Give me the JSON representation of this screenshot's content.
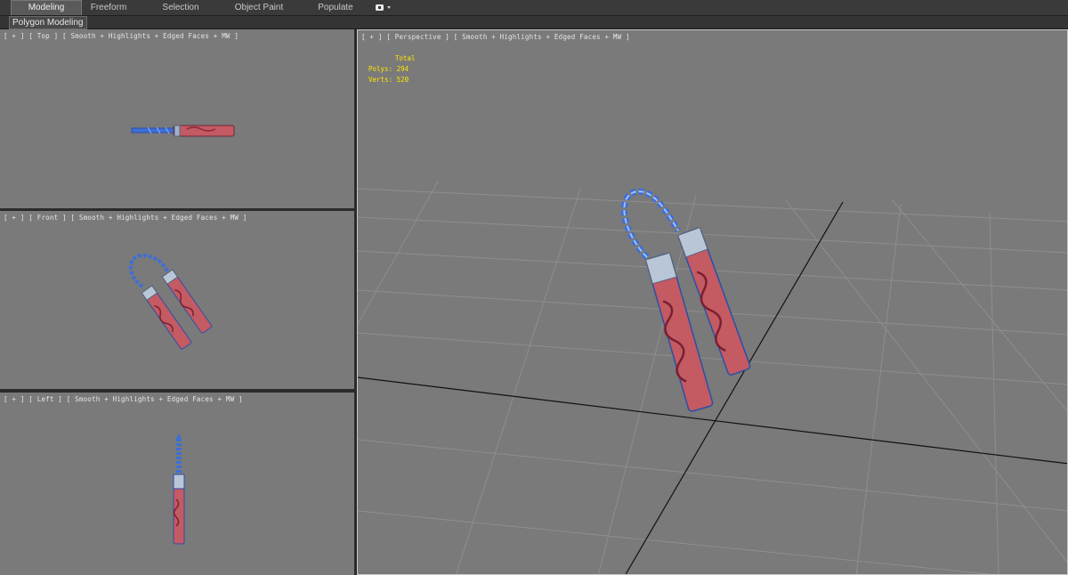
{
  "ribbon": {
    "tabs": [
      {
        "label": "Modeling",
        "active": true
      },
      {
        "label": "Freeform",
        "active": false
      },
      {
        "label": "Selection",
        "active": false
      },
      {
        "label": "Object Paint",
        "active": false
      },
      {
        "label": "Populate",
        "active": false
      }
    ],
    "dropdown_icon": "display-toggle-icon"
  },
  "subbar": {
    "panel_label": "Polygon Modeling"
  },
  "viewports": {
    "top": {
      "label": "[ + ] [ Top ] [ Smooth + Highlights + Edged Faces + MW ]"
    },
    "front": {
      "label": "[ + ] [ Front ] [ Smooth + Highlights + Edged Faces + MW ]"
    },
    "left": {
      "label": "[ + ] [ Left ] [ Smooth + Highlights + Edged Faces + MW ]"
    },
    "perspective": {
      "label": "[ + ] [ Perspective ] [ Smooth + Highlights + Edged Faces + MW ]",
      "stats": {
        "header": "Total",
        "polys": "Polys: 294",
        "verts": "Verts: 520"
      }
    }
  },
  "colors": {
    "viewport_bg": "#7a7a7a",
    "stats_text": "#ffe600",
    "stick_red": "#c45a62",
    "chain_blue": "#3d6fd6",
    "metal": "#b8c6d8"
  }
}
